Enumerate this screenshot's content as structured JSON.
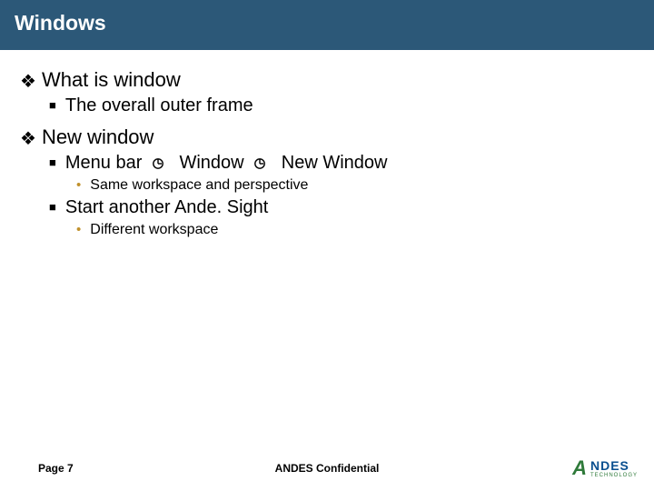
{
  "title": "Windows",
  "bullets": {
    "a1": "What is window",
    "a1_1": "The overall outer frame",
    "a2": "New window",
    "a2_1_pre": "Menu bar",
    "a2_1_mid": "Window",
    "a2_1_post": "New Window",
    "a2_1_1": "Same workspace and perspective",
    "a2_2": "Start another Ande. Sight",
    "a2_2_1": "Different workspace"
  },
  "footer": {
    "page_label": "Page 7",
    "confidential": "ANDES Confidential"
  },
  "logo": {
    "mark": "A",
    "brand": "NDES",
    "tag": "TECHNOLOGY"
  }
}
